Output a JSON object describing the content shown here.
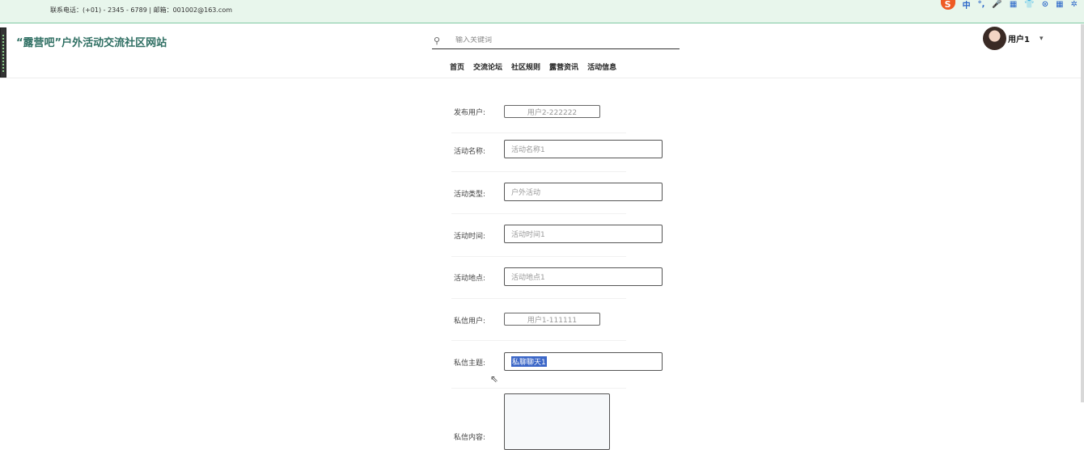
{
  "topbar": {
    "contact": "联系电话：(+01) - 2345 - 6789 | 邮箱：001002@163.com",
    "ime": [
      "中",
      "°,",
      "🎤",
      "▦",
      "👕",
      "⊙",
      "▦",
      "✲"
    ]
  },
  "header": {
    "title": "“露营吧”户外活动交流社区网站",
    "search_placeholder": "输入关键词",
    "nav": [
      "首页",
      "交流论坛",
      "社区规则",
      "露营资讯",
      "活动信息"
    ],
    "user": {
      "name": "用户1",
      "caret": "▾"
    }
  },
  "form": {
    "fields": [
      {
        "label": "发布用户:",
        "value": "用户2-222222"
      },
      {
        "label": "活动名称:",
        "placeholder": "活动名称1"
      },
      {
        "label": "活动类型:",
        "placeholder": "户外活动"
      },
      {
        "label": "活动时间:",
        "placeholder": "活动时间1"
      },
      {
        "label": "活动地点:",
        "placeholder": "活动地点1"
      },
      {
        "label": "私信用户:",
        "value": "用户1-111111"
      },
      {
        "label": "私信主题:",
        "value": "私聊聊天1"
      },
      {
        "label": "私信内容:"
      }
    ]
  }
}
